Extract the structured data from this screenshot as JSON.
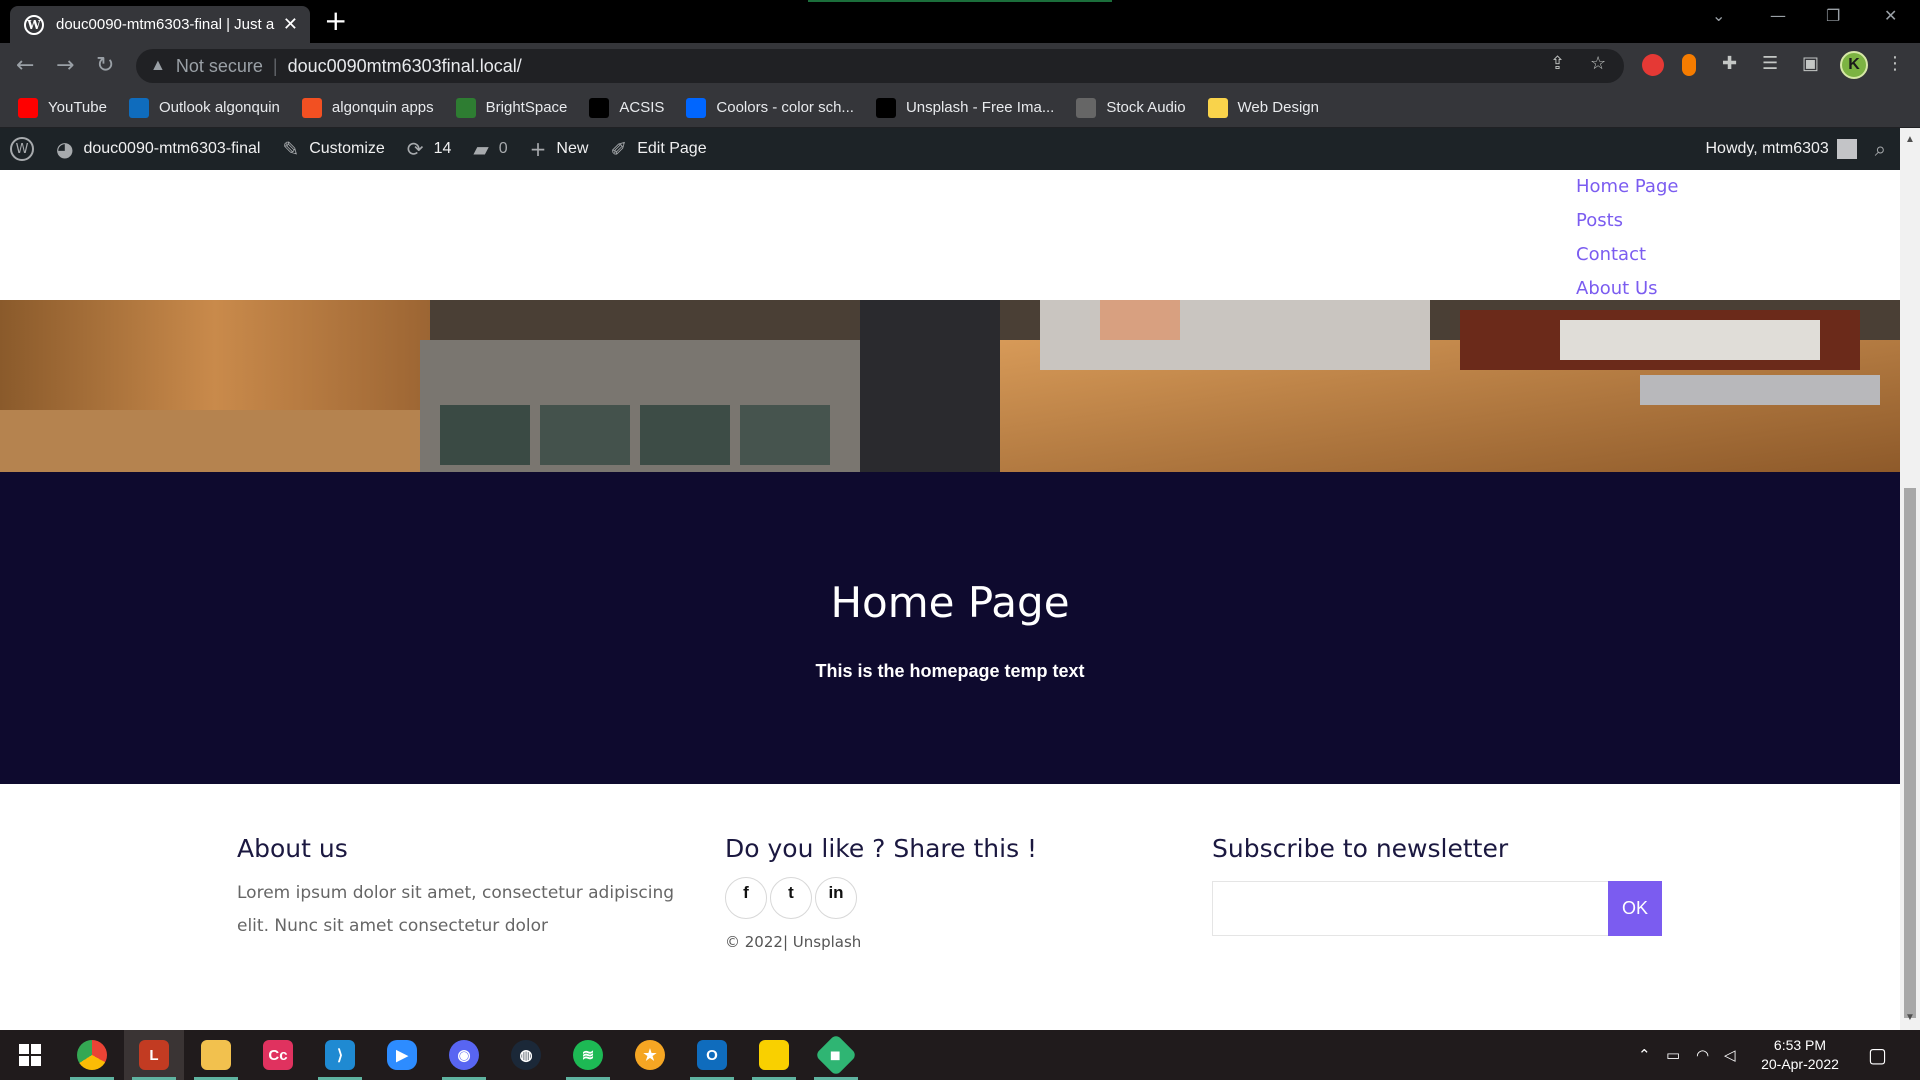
{
  "browser": {
    "tab_title": "douc0090-mtm6303-final | Just a",
    "security_label": "Not secure",
    "url": "douc0090mtm6303final.local/",
    "profile_initial": "K",
    "bookmarks": [
      {
        "label": "YouTube",
        "icon": "youtube-icon",
        "color": "#ff0000"
      },
      {
        "label": "Outlook algonquin",
        "icon": "outlook-icon",
        "color": "#0f6cbd"
      },
      {
        "label": "algonquin apps",
        "icon": "microsoft-icon",
        "color": "#f25022"
      },
      {
        "label": "BrightSpace",
        "icon": "brightspace-icon",
        "color": "#2e7d32"
      },
      {
        "label": "ACSIS",
        "icon": "acsis-icon",
        "color": "#000000"
      },
      {
        "label": "Coolors - color sch...",
        "icon": "coolors-icon",
        "color": "#0066ff"
      },
      {
        "label": "Unsplash - Free Ima...",
        "icon": "unsplash-icon",
        "color": "#000000"
      },
      {
        "label": "Stock Audio",
        "icon": "stock-audio-icon",
        "color": "#666666"
      },
      {
        "label": "Web Design",
        "icon": "folder-icon",
        "color": "#f9d34b"
      }
    ]
  },
  "adminbar": {
    "site_name": "douc0090-mtm6303-final",
    "customize": "Customize",
    "updates_count": "14",
    "comments_count": "0",
    "new_label": "New",
    "edit_label": "Edit Page",
    "howdy": "Howdy, mtm6303"
  },
  "site": {
    "nav": [
      "Home Page",
      "Posts",
      "Contact",
      "About Us"
    ],
    "accent": "#7b5cf0",
    "banner_bg": "#0e0a2e"
  },
  "banner": {
    "title": "Home Page",
    "text": "This is the homepage temp text"
  },
  "footer": {
    "about_title": "About us",
    "about_text": "Lorem ipsum dolor sit amet, consectetur adipiscing elit. Nunc sit amet consectetur dolor",
    "share_title": "Do you like ? Share this !",
    "social": [
      {
        "label": "f",
        "icon": "facebook-icon"
      },
      {
        "label": "t",
        "icon": "twitter-icon"
      },
      {
        "label": "in",
        "icon": "linkedin-icon"
      }
    ],
    "copyright": "© 2022| Unsplash",
    "newsletter_title": "Subscribe to newsletter",
    "newsletter_button": "OK"
  },
  "taskbar": {
    "time": "6:53 PM",
    "date": "20-Apr-2022"
  }
}
